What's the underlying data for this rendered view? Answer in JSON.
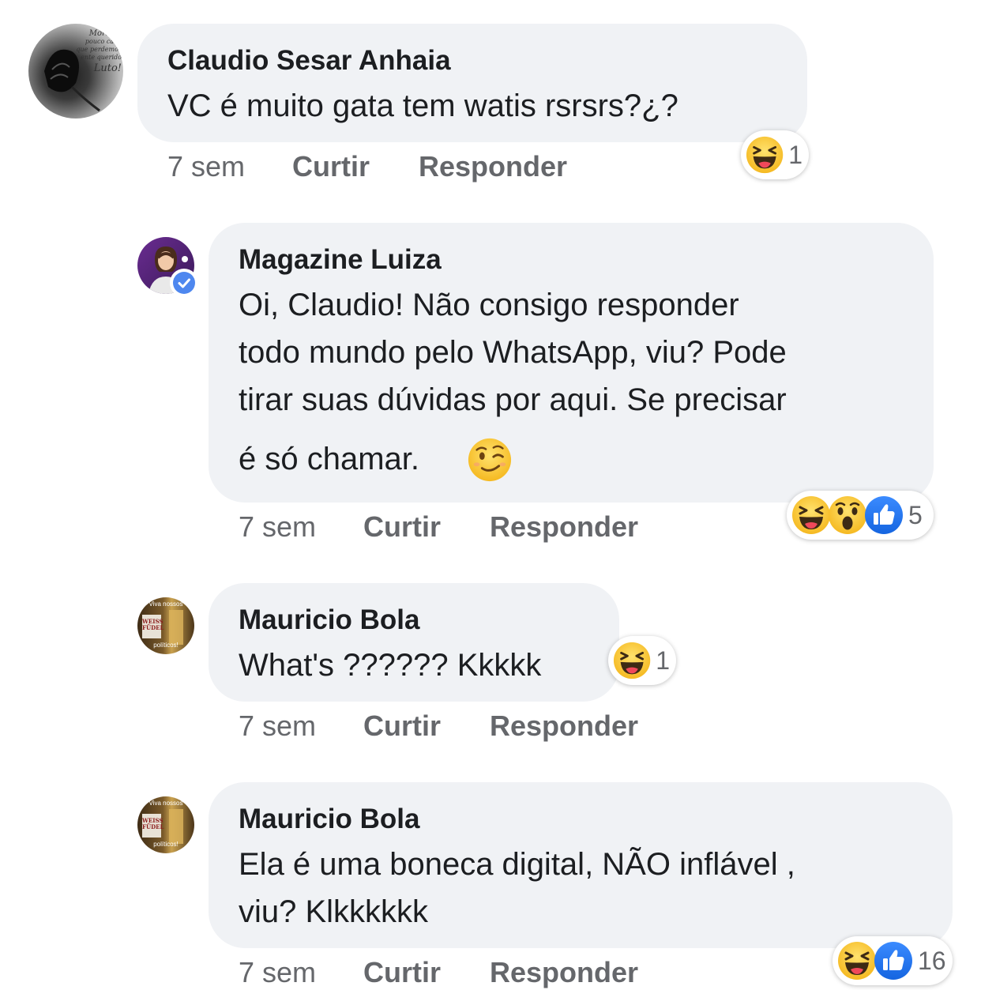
{
  "comments": [
    {
      "author": "Claudio Sesar Anhaia",
      "text_lines": [
        "VC é muito gata tem watis rsrsrs?¿?"
      ],
      "time": "7 sem",
      "like_label": "Curtir",
      "reply_label": "Responder",
      "reactions": {
        "icons": [
          "haha-icon"
        ],
        "count": "1"
      },
      "avatar_text": [
        "Morrem",
        "pouco cada",
        "que perdemos",
        "ente querido",
        "Luto!"
      ]
    },
    {
      "author": "Magazine Luiza",
      "verified": true,
      "text_lines": [
        "Oi, Claudio! Não consigo responder",
        "todo mundo pelo WhatsApp, viu? Pode",
        "tirar suas dúvidas por aqui. Se precisar",
        "é só chamar."
      ],
      "emoji": "wink-emoji",
      "time": "7 sem",
      "like_label": "Curtir",
      "reply_label": "Responder",
      "reactions": {
        "icons": [
          "haha-icon",
          "wow-icon",
          "like-icon"
        ],
        "count": "5"
      }
    },
    {
      "author": "Mauricio Bola",
      "text_lines": [
        "What's ?????? Kkkkk"
      ],
      "time": "7 sem",
      "like_label": "Curtir",
      "reply_label": "Responder",
      "reactions": {
        "icons": [
          "haha-icon"
        ],
        "count": "1"
      },
      "avatar_text": [
        "Viva nossos",
        "WEISS",
        "FÜDEL",
        "políticos!"
      ]
    },
    {
      "author": "Mauricio Bola",
      "text_lines": [
        "Ela é  uma boneca digital, NÃO inflável  ,",
        "viu? Klkkkkkk"
      ],
      "time": "7 sem",
      "like_label": "Curtir",
      "reply_label": "Responder",
      "reactions": {
        "icons": [
          "haha-icon",
          "like-icon"
        ],
        "count": "16"
      },
      "avatar_text": [
        "Viva nossos",
        "WEISS",
        "FÜDEL",
        "políticos!"
      ]
    }
  ],
  "colors": {
    "bubble": "#f0f2f5",
    "meta": "#65676b",
    "like_blue": "#1877f2",
    "emoji_yellow": "#fcc73a"
  }
}
